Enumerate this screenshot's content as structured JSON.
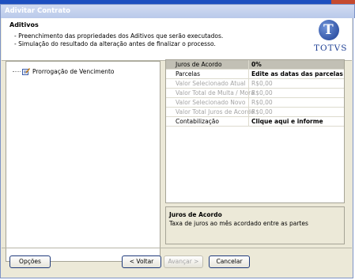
{
  "window": {
    "title": "Adivitar Contrato"
  },
  "header": {
    "title": "Aditivos",
    "lines": [
      "- Preenchimento das propriedades dos Aditivos que serão executados.",
      "- Simulação do resultado da alteração antes de finalizar o processo."
    ],
    "logo_text": "TOTVS",
    "logo_glyph": "T"
  },
  "tree": {
    "items": [
      {
        "label": "Prorrogação de Vencimento",
        "icon": "form-edit-icon"
      }
    ]
  },
  "properties": [
    {
      "key": "Juros de Acordo",
      "value": "0%",
      "state": "selected"
    },
    {
      "key": "Parcelas",
      "value": "Edite as datas das parcelas",
      "state": "normal"
    },
    {
      "key": "Valor Selecionado Atual",
      "value": "R$0,00",
      "state": "disabled"
    },
    {
      "key": "Valor Total de Multa / Mora",
      "value": "R$0,00",
      "state": "disabled"
    },
    {
      "key": "Valor Selecionado Novo",
      "value": "R$0,00",
      "state": "disabled"
    },
    {
      "key": "Valor Total Juros de Acordo",
      "value": "R$0,00",
      "state": "disabled"
    },
    {
      "key": "Contabilização",
      "value": "Clique aqui e informe",
      "state": "normal"
    }
  ],
  "description": {
    "title": "Juros de Acordo",
    "text": "Taxa de juros ao mês acordado entre as partes"
  },
  "buttons": {
    "options": "Opções",
    "back": "< Voltar",
    "next": "Avançar >",
    "cancel": "Cancelar"
  },
  "colors": {
    "title_bar": "#b9c9ea",
    "face": "#ece9d8",
    "brand": "#1d3f94"
  }
}
